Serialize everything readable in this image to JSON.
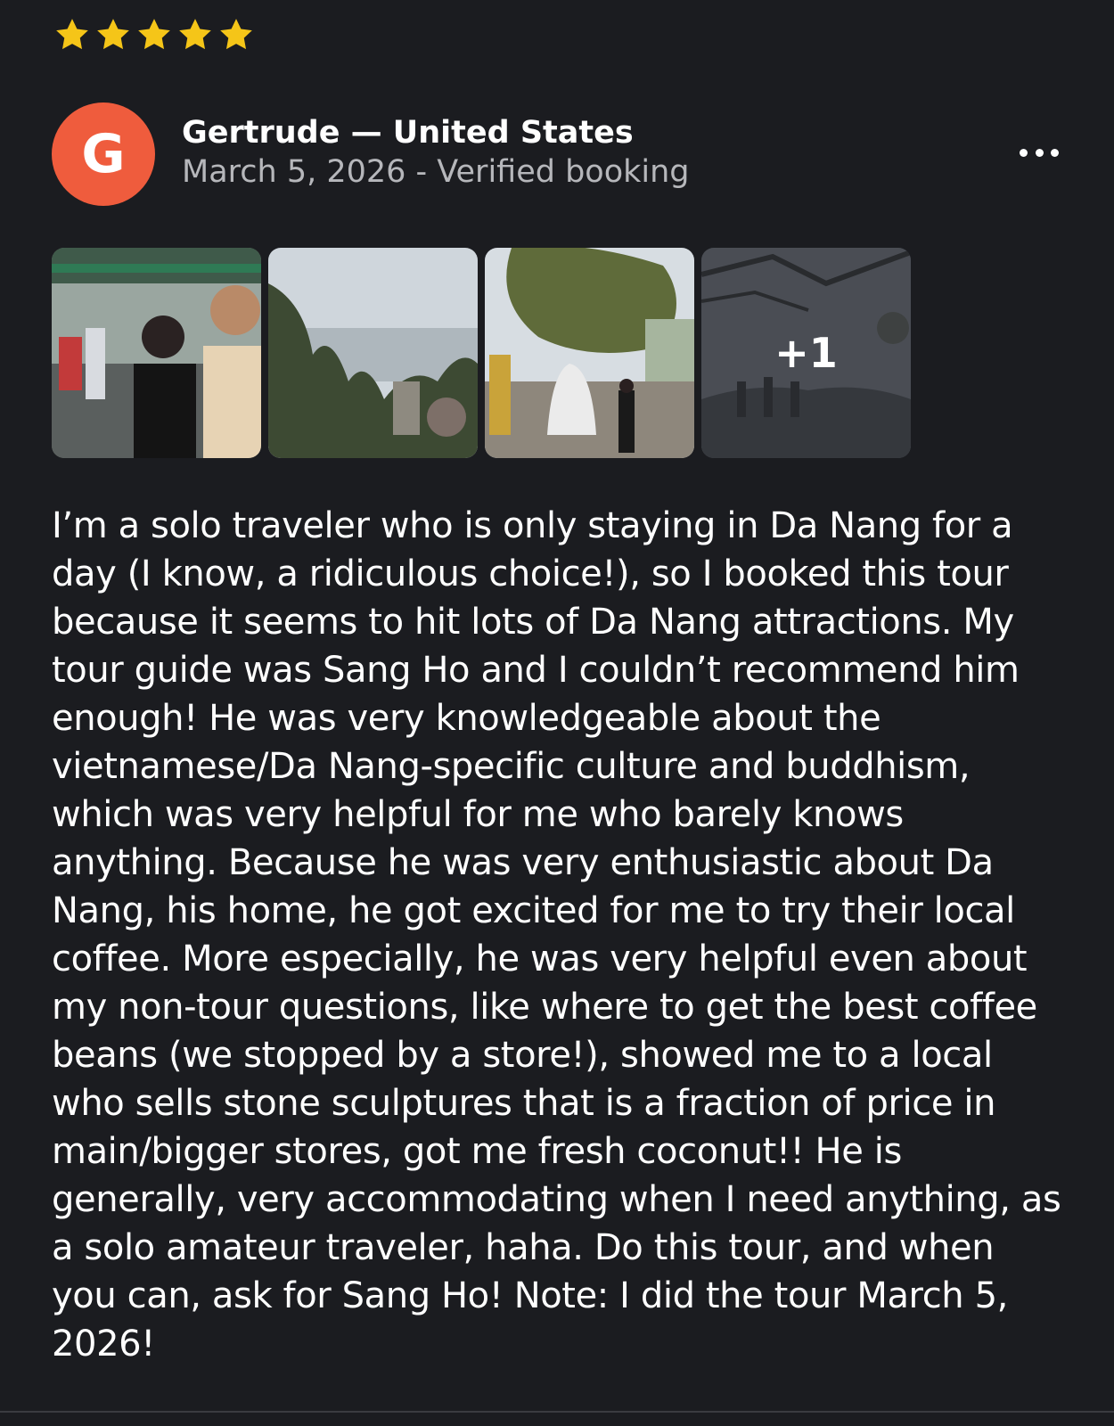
{
  "rating": {
    "stars": 5,
    "max": 5,
    "color": "#f5c518"
  },
  "reviewer": {
    "avatar_letter": "G",
    "avatar_color": "#ef5c3d",
    "name_country": "Gertrude — United States",
    "date_status": "March 5, 2026 - Verified booking"
  },
  "photos": {
    "extra_count": "+1"
  },
  "review_text": "I’m a solo traveler who is only staying in Da Nang for a day (I know, a ridiculous choice!), so I booked this tour because it seems to hit lots of Da Nang attractions. My tour guide was Sang Ho and I couldn’t recommend him enough! He was very knowledgeable about the vietnamese/Da Nang-specific culture and buddhism, which was very helpful for me who barely knows anything. Because he was very enthusiastic about Da Nang, his home, he got excited for me to try their local coffee. More especially, he was very helpful even about my non-tour questions, like where to get the best coffee beans (we stopped by a store!), showed me to a local who sells stone sculptures that is a fraction of price in main/bigger stores, got me fresh coconut!! He is generally, very accommodating when I need anything, as a solo amateur traveler, haha. Do this tour, and when you can, ask for Sang Ho! Note: I did the tour March 5, 2026!"
}
